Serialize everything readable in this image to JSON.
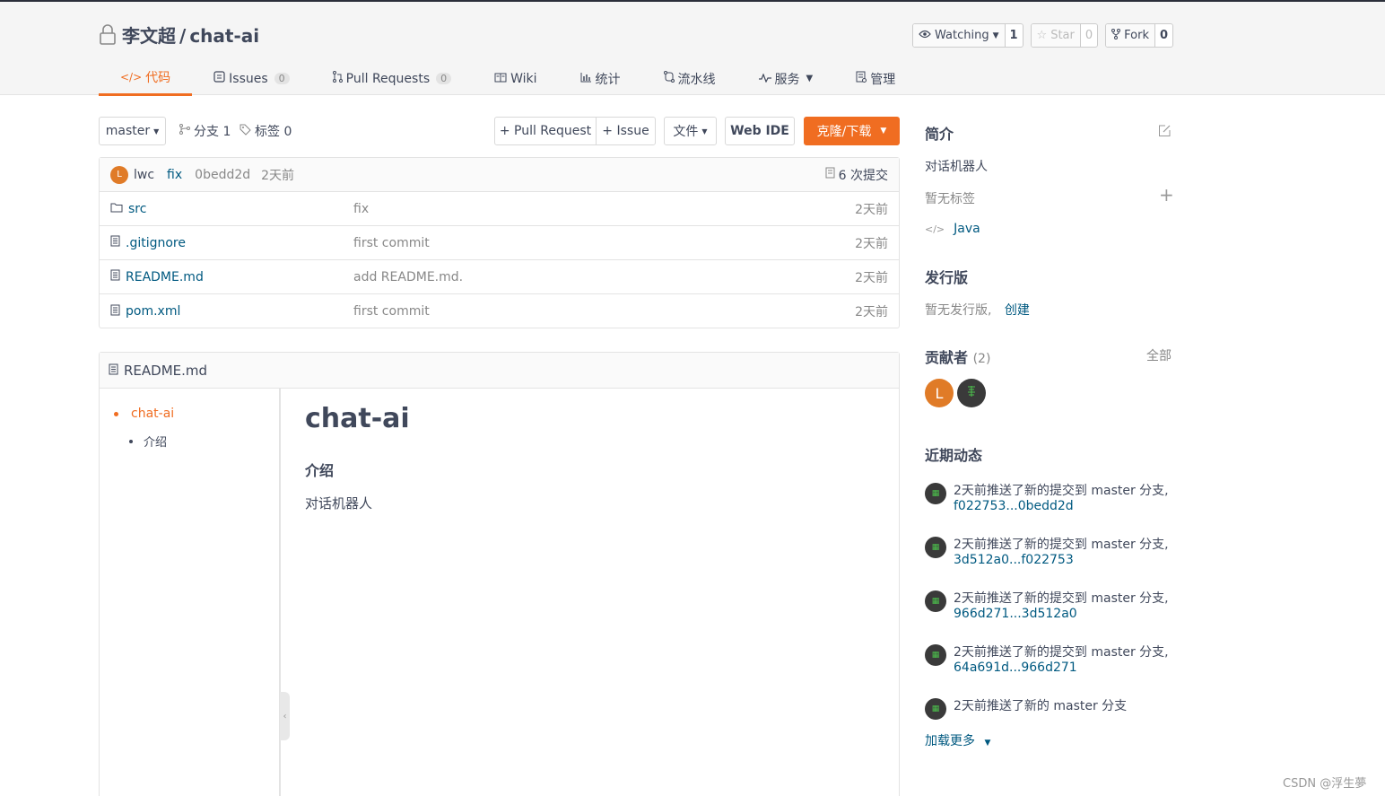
{
  "repo": {
    "owner": "李文超",
    "separator": "/",
    "name": "chat-ai"
  },
  "actions": {
    "watch": {
      "label": "Watching",
      "count": "1"
    },
    "star": {
      "label": "Star",
      "count": "0"
    },
    "fork": {
      "label": "Fork",
      "count": "0"
    }
  },
  "tabs": [
    {
      "label": "代码",
      "icon": "code-icon"
    },
    {
      "label": "Issues",
      "badge": "0",
      "icon": "issue-icon"
    },
    {
      "label": "Pull Requests",
      "badge": "0",
      "icon": "pull-request-icon"
    },
    {
      "label": "Wiki",
      "icon": "book-icon"
    },
    {
      "label": "统计",
      "icon": "bar-chart-icon"
    },
    {
      "label": "流水线",
      "icon": "pipeline-icon"
    },
    {
      "label": "服务",
      "icon": "pulse-icon"
    },
    {
      "label": "管理",
      "icon": "settings-doc-icon"
    }
  ],
  "toolbar": {
    "branch": "master",
    "branches_label": "分支 1",
    "tags_label": "标签 0",
    "pull_request": "+ Pull Request",
    "issue": "+ Issue",
    "file": "文件",
    "web_ide": "Web IDE",
    "clone": "克隆/下载"
  },
  "last_commit": {
    "avatar_letter": "L",
    "author": "lwc",
    "message": "fix",
    "sha": "0bedd2d",
    "time": "2天前",
    "commits_label": "6 次提交"
  },
  "files": [
    {
      "name": "src",
      "type": "folder",
      "message": "fix",
      "time": "2天前"
    },
    {
      "name": ".gitignore",
      "type": "file",
      "message": "first commit",
      "time": "2天前"
    },
    {
      "name": "README.md",
      "type": "file",
      "message": "add README.md.",
      "time": "2天前"
    },
    {
      "name": "pom.xml",
      "type": "file",
      "message": "first commit",
      "time": "2天前"
    }
  ],
  "readme": {
    "filename": "README.md",
    "toc": {
      "h1": "chat-ai",
      "h2": "介绍"
    },
    "h1": "chat-ai",
    "h2": "介绍",
    "body": "对话机器人"
  },
  "sidebar": {
    "intro_title": "简介",
    "description": "对话机器人",
    "no_tags": "暂无标签",
    "language": "Java",
    "releases_title": "发行版",
    "no_releases": "暂无发行版,",
    "create": "创建",
    "contributors_title": "贡献者",
    "contributors_count": "(2)",
    "all": "全部",
    "contributor_letter": "L",
    "activity_title": "近期动态",
    "activity": [
      {
        "text": "2天前推送了新的提交到 master 分支,",
        "range": "f022753...0bedd2d"
      },
      {
        "text": "2天前推送了新的提交到 master 分支,",
        "range": "3d512a0...f022753"
      },
      {
        "text": "2天前推送了新的提交到 master 分支,",
        "range": "966d271...3d512a0"
      },
      {
        "text": "2天前推送了新的提交到 master 分支,",
        "range": "64a691d...966d271"
      },
      {
        "text": "2天前推送了新的 master 分支",
        "range": ""
      }
    ],
    "load_more": "加载更多"
  },
  "watermark": "CSDN @浮生夢",
  "colors": {
    "accent": "#f06d21",
    "link": "#005980",
    "text": "#40485b"
  }
}
